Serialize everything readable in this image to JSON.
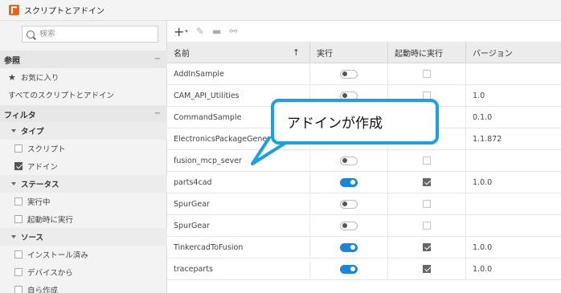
{
  "window": {
    "title": "スクリプトとアドイン"
  },
  "search": {
    "placeholder": "検索"
  },
  "sidebar": {
    "reference": {
      "title": "参照",
      "collapse": "−",
      "favorites": "お気に入り",
      "all": "すべてのスクリプトとアドイン"
    },
    "filter": {
      "title": "フィルタ",
      "collapse": "−",
      "type": {
        "title": "タイプ",
        "options": [
          {
            "label": "スクリプト",
            "checked": false
          },
          {
            "label": "アドイン",
            "checked": true
          }
        ]
      },
      "status": {
        "title": "ステータス",
        "options": [
          {
            "label": "実行中",
            "checked": false
          },
          {
            "label": "起動時に実行",
            "checked": false
          }
        ]
      },
      "source": {
        "title": "ソース",
        "options": [
          {
            "label": "インストール済み",
            "checked": false
          },
          {
            "label": "デバイスから",
            "checked": false
          },
          {
            "label": "自ら作成",
            "checked": false
          }
        ]
      }
    }
  },
  "toolbar": {
    "plus": "+",
    "dropdown": "▾",
    "edit": "✎",
    "folder": "▬",
    "unlink": "⚯"
  },
  "table": {
    "headers": {
      "name": "名前",
      "sort": "↑",
      "run": "実行",
      "startup": "起動時に実行",
      "version": "バージョン"
    },
    "rows": [
      {
        "name": "AddInSample",
        "run": false,
        "startup": false,
        "version": ""
      },
      {
        "name": "CAM_API_Utilities",
        "run": false,
        "startup": false,
        "version": "1.0"
      },
      {
        "name": "CommandSample",
        "run": false,
        "startup": false,
        "version": "0.1.0"
      },
      {
        "name": "ElectronicsPackageGener",
        "run": false,
        "startup": false,
        "version": "1.1.872"
      },
      {
        "name": "fusion_mcp_sever",
        "run": false,
        "startup": false,
        "version": ""
      },
      {
        "name": "parts4cad",
        "run": true,
        "startup": true,
        "version": "1.0.0"
      },
      {
        "name": "SpurGear",
        "run": false,
        "startup": false,
        "version": ""
      },
      {
        "name": "SpurGear",
        "run": false,
        "startup": false,
        "version": ""
      },
      {
        "name": "TinkercadToFusion",
        "run": true,
        "startup": true,
        "version": "1.0.0"
      },
      {
        "name": "traceparts",
        "run": true,
        "startup": true,
        "version": "1.0.0"
      }
    ]
  },
  "callout": {
    "text": "アドインが作成"
  },
  "colors": {
    "accent": "#1e9fe0",
    "toggle_on": "#1a86d9",
    "app_icon": "#e8631a"
  }
}
